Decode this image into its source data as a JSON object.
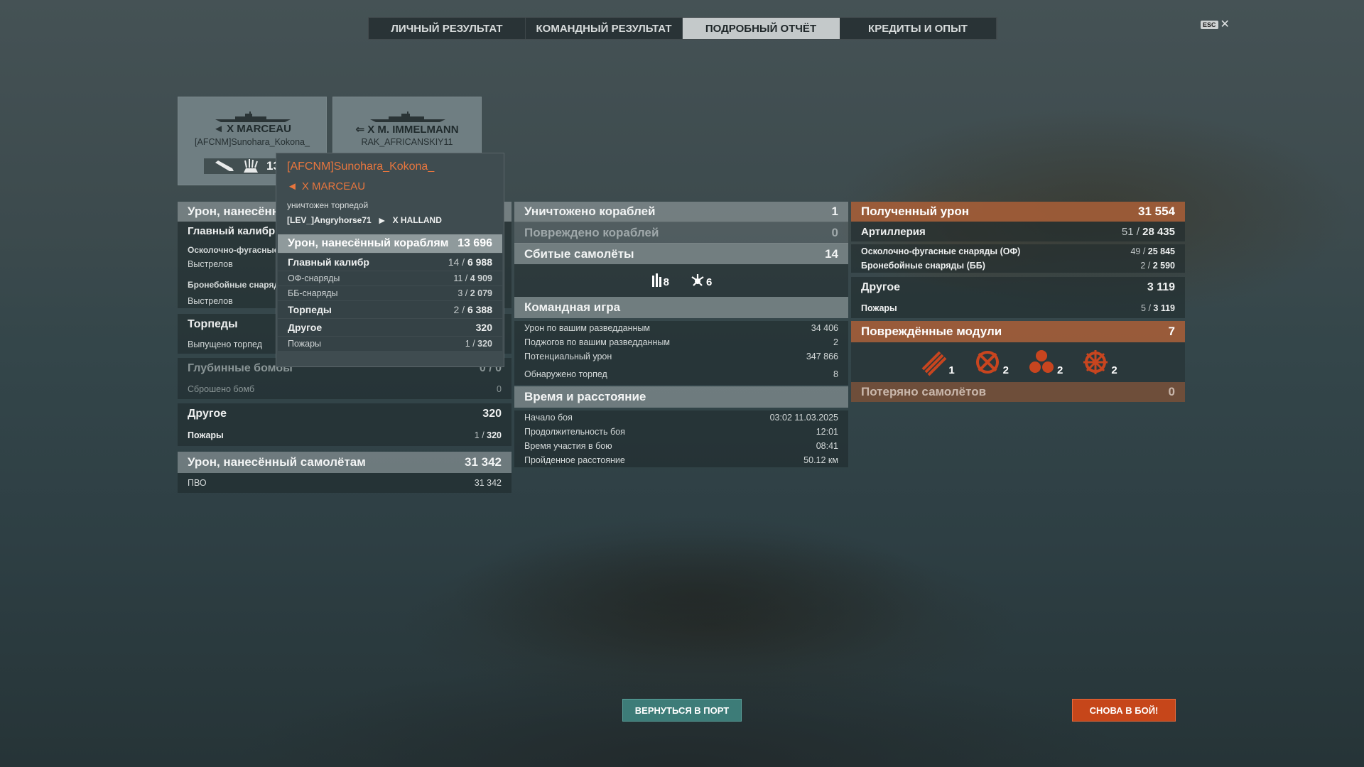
{
  "tabs": [
    {
      "label": "ЛИЧНЫЙ РЕЗУЛЬТАТ"
    },
    {
      "label": "КОМАНДНЫЙ РЕЗУЛЬТАТ"
    },
    {
      "label": "ПОДРОБНЫЙ ОТЧЁТ",
      "active": true
    },
    {
      "label": "КРЕДИТЫ И ОПЫТ"
    }
  ],
  "esc": {
    "key": "ESC",
    "close": "✕"
  },
  "cards": [
    {
      "ship": "X MARCEAU",
      "player": "[AFCNM]Sunohara_Kokona_",
      "damage": "13 6"
    },
    {
      "ship": "X M. IMMELMANN",
      "player": "RAK_AFRICANSKIY11"
    }
  ],
  "tooltip": {
    "player": "[AFCNM]Sunohara_Kokona_",
    "ship": "X MARCEAU",
    "status": "уничтожен торпедой",
    "killer": "[LEV_]Angryhorse71",
    "killer_ship": "X HALLAND",
    "damage_header": {
      "label": "Урон, нанесённый кораблям",
      "value": "13 696"
    },
    "main_caliber": {
      "label": "Главный калибр",
      "hits": "14",
      "value": "6 988"
    },
    "he": {
      "label": "ОФ-снаряды",
      "hits": "11",
      "value": "4 909"
    },
    "ap": {
      "label": "ББ-снаряды",
      "hits": "3",
      "value": "2 079"
    },
    "torpedoes": {
      "label": "Торпеды",
      "hits": "2",
      "value": "6 388"
    },
    "other": {
      "label": "Другое",
      "value": "320"
    },
    "fires": {
      "label": "Пожары",
      "hits": "1",
      "value": "320"
    }
  },
  "left": {
    "damage_header": "Урон, нанесённ",
    "main_caliber": "Главный калибр",
    "he_label": "Осколочно-фугасные",
    "shots1": "Выстрелов",
    "ap_label": "Бронебойные снаряд",
    "shots2": "Выстрелов",
    "torpedoes": "Торпеды",
    "torps_fired": "Выпущено торпед",
    "depth_charges": {
      "label": "Глубинные бомбы",
      "value": "0 / 0"
    },
    "bombs_dropped": {
      "label": "Сброшено бомб",
      "value": "0"
    },
    "other": {
      "label": "Другое",
      "value": "320"
    },
    "fires": {
      "label": "Пожары",
      "hits": "1",
      "value": "320"
    },
    "planes_damage": {
      "label": "Урон, нанесённый самолётам",
      "value": "31 342"
    },
    "aa": {
      "label": "ПВО",
      "value": "31 342"
    }
  },
  "middle": {
    "destroyed": {
      "label": "Уничтожено кораблей",
      "value": "1"
    },
    "damaged": {
      "label": "Повреждено кораблей",
      "value": "0"
    },
    "planes": {
      "label": "Сбитые самолёты",
      "value": "14"
    },
    "plane_types": [
      {
        "icon": "fighter-icon",
        "count": "8"
      },
      {
        "icon": "bomber-icon",
        "count": "6"
      }
    ],
    "team": {
      "header": "Командная игра",
      "rows": [
        {
          "label": "Урон по вашим разведданным",
          "value": "34 406"
        },
        {
          "label": "Поджогов по вашим разведданным",
          "value": "2"
        },
        {
          "label": "Потенциальный урон",
          "value": "347 866"
        },
        {
          "label": "Обнаружено торпед",
          "value": "8"
        }
      ]
    },
    "time": {
      "header": "Время и расстояние",
      "rows": [
        {
          "label": "Начало боя",
          "value": "03:02  11.03.2025"
        },
        {
          "label": "Продолжительность боя",
          "value": "12:01"
        },
        {
          "label": "Время участия в бою",
          "value": "08:41"
        },
        {
          "label": "Пройденное расстояние",
          "value": "50.12 км"
        }
      ]
    }
  },
  "right": {
    "received": {
      "label": "Полученный урон",
      "value": "31 554"
    },
    "artillery": {
      "label": "Артиллерия",
      "hits": "51",
      "value": "28 435"
    },
    "he": {
      "label": "Осколочно-фугасные снаряды (ОФ)",
      "hits": "49",
      "value": "25 845"
    },
    "ap": {
      "label": "Бронебойные снаряды (ББ)",
      "hits": "2",
      "value": "2 590"
    },
    "other": {
      "label": "Другое",
      "value": "3 119"
    },
    "fires": {
      "label": "Пожары",
      "hits": "5",
      "value": "3 119"
    },
    "modules": {
      "label": "Повреждённые модули",
      "value": "7"
    },
    "module_icons": [
      {
        "icon": "torpedo-tubes-icon",
        "count": "1"
      },
      {
        "icon": "main-battery-icon",
        "count": "2"
      },
      {
        "icon": "engine-icon",
        "count": "2"
      },
      {
        "icon": "steering-gear-icon",
        "count": "2"
      }
    ],
    "planes_lost": {
      "label": "Потеряно самолётов",
      "value": "0"
    }
  },
  "buttons": {
    "port": "ВЕРНУТЬСЯ В ПОРТ",
    "battle": "СНОВА В БОЙ!"
  },
  "colors": {
    "accent_orange": "#e8763e",
    "port_button": "#3d7c78",
    "battle_button": "#c6461a"
  }
}
